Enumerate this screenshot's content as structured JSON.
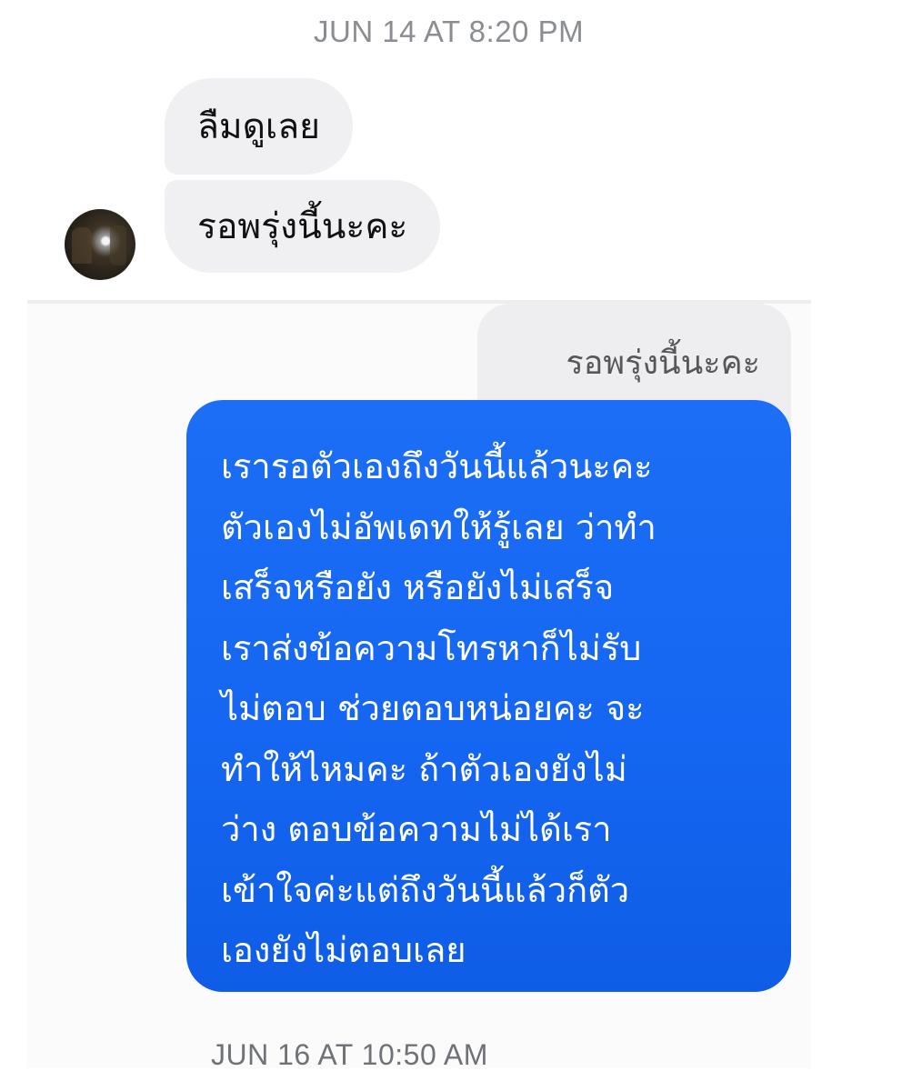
{
  "top_panel": {
    "timestamp": "JUN 14 AT 8:20 PM",
    "messages": [
      {
        "text": "ลืมดูเลย"
      },
      {
        "text": "รอพรุ่งนี้นะคะ"
      }
    ],
    "avatar_icon": "contact-avatar"
  },
  "bottom_panel": {
    "reply_preview": "รอพรุ่งนี้นะคะ",
    "sent_message_lines": [
      "เรารอตัวเองถึงวันนี้แล้วนะคะ",
      "ตัวเองไม่อัพเดทให้รู้เลย ว่าทำ",
      "เสร็จหรือยัง หรือยังไม่เสร็จ",
      "เราส่งข้อความโทรหาก็ไม่รับ",
      "ไม่ตอบ ช่วยตอบหน่อยคะ จะ",
      "ทำให้ไหมคะ ถ้าตัวเองยังไม่",
      "ว่าง ตอบข้อความไม่ได้เรา",
      "เข้าใจค่ะแต่ถึงวันนี้แล้วก็ตัว",
      "เองยังไม่ตอบเลย"
    ],
    "timestamp": "JUN 16 AT 10:50 AM"
  },
  "colors": {
    "sent_bubble": "#1566f2",
    "received_bubble": "#f0f0f3",
    "timestamp_text": "#8a8d91"
  }
}
